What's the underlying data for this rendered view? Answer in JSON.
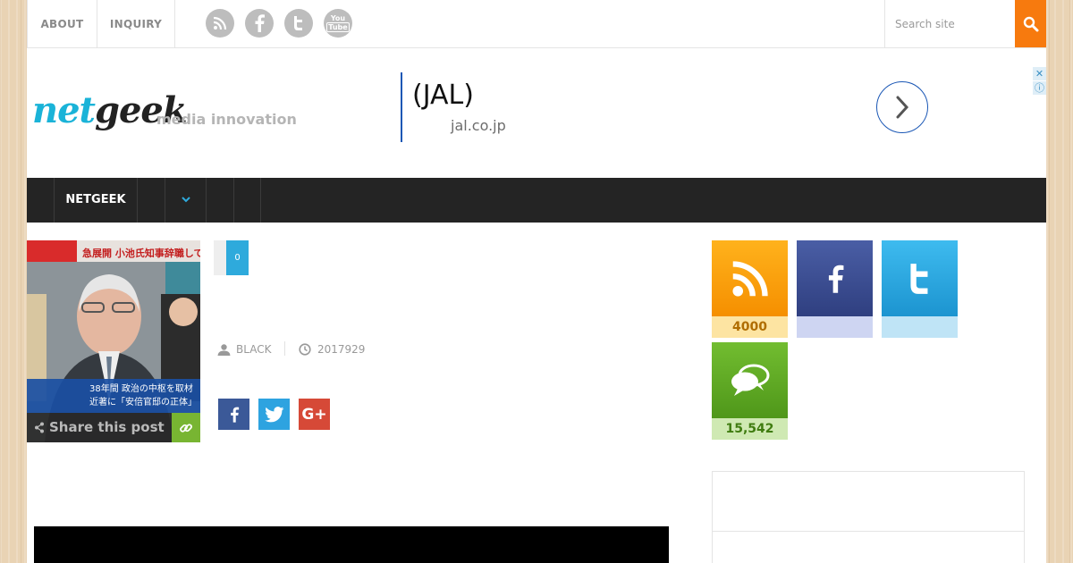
{
  "topbar": {
    "nav": [
      {
        "label": "ABOUT"
      },
      {
        "label": "INQUIRY"
      }
    ],
    "social": [
      {
        "icon": "rss-icon"
      },
      {
        "icon": "facebook-icon"
      },
      {
        "icon": "twitter-icon"
      },
      {
        "icon": "youtube-icon",
        "label": "You Tube"
      }
    ],
    "search": {
      "placeholder": "Search site"
    }
  },
  "header": {
    "logo": {
      "part1": "net",
      "part2": "geek",
      "tagline": "media innovation"
    },
    "ad": {
      "title": "(JAL)",
      "url": "jal.co.jp",
      "close": "✕",
      "info": "ⓘ"
    }
  },
  "mainnav": {
    "items": [
      {
        "label": "NETGEEK"
      },
      {
        "label": ""
      },
      {
        "label": "⌄"
      },
      {
        "label": ""
      },
      {
        "label": ""
      }
    ]
  },
  "article": {
    "thumbnail": {
      "banner_top": "急展開 小池氏知事辞職して",
      "caption_line1": "38年間 政治の中枢を取材",
      "caption_line2": "近著に「安倍官邸の正体」"
    },
    "share_label": "Share this post",
    "comment_count": "0",
    "author": "BLACK",
    "date": "2017929",
    "share_buttons": [
      {
        "icon": "facebook-icon",
        "color": "#3b5998"
      },
      {
        "icon": "twitter-icon",
        "color": "#2ea3e0"
      },
      {
        "icon": "google-plus-icon",
        "label": "G+",
        "color": "#d64937"
      }
    ]
  },
  "sidebar": {
    "tiles": [
      {
        "icon": "rss-icon",
        "count": "4000",
        "color": "#f8a10c",
        "count_bg": "#fde4a2",
        "count_color": "#b06d00"
      },
      {
        "icon": "facebook-icon",
        "count": "",
        "color": "#3d4f96",
        "count_bg": "#ced5f2",
        "count_color": "#3d4f96"
      },
      {
        "icon": "twitter-icon",
        "count": "",
        "color": "#29a6e0",
        "count_bg": "#bfe4f6",
        "count_color": "#1c7fae"
      },
      {
        "icon": "chat-icon",
        "count": "15,542",
        "color": "#62ad27",
        "count_bg": "#cfe9b3",
        "count_color": "#3f7c10"
      }
    ]
  }
}
